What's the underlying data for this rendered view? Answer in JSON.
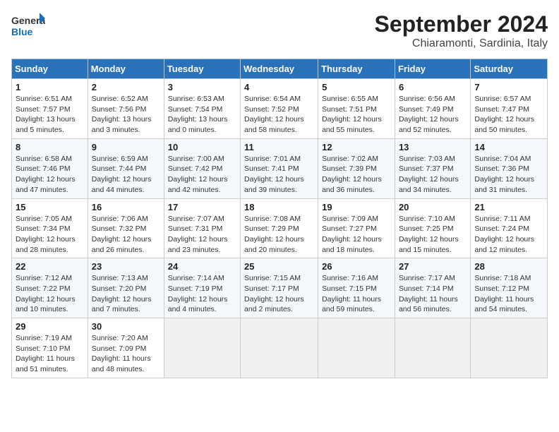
{
  "header": {
    "logo_general": "General",
    "logo_blue": "Blue",
    "month": "September 2024",
    "location": "Chiaramonti, Sardinia, Italy"
  },
  "weekdays": [
    "Sunday",
    "Monday",
    "Tuesday",
    "Wednesday",
    "Thursday",
    "Friday",
    "Saturday"
  ],
  "weeks": [
    [
      {
        "day": "1",
        "sunrise": "6:51 AM",
        "sunset": "7:57 PM",
        "daylight": "13 hours and 5 minutes."
      },
      {
        "day": "2",
        "sunrise": "6:52 AM",
        "sunset": "7:56 PM",
        "daylight": "13 hours and 3 minutes."
      },
      {
        "day": "3",
        "sunrise": "6:53 AM",
        "sunset": "7:54 PM",
        "daylight": "13 hours and 0 minutes."
      },
      {
        "day": "4",
        "sunrise": "6:54 AM",
        "sunset": "7:52 PM",
        "daylight": "12 hours and 58 minutes."
      },
      {
        "day": "5",
        "sunrise": "6:55 AM",
        "sunset": "7:51 PM",
        "daylight": "12 hours and 55 minutes."
      },
      {
        "day": "6",
        "sunrise": "6:56 AM",
        "sunset": "7:49 PM",
        "daylight": "12 hours and 52 minutes."
      },
      {
        "day": "7",
        "sunrise": "6:57 AM",
        "sunset": "7:47 PM",
        "daylight": "12 hours and 50 minutes."
      }
    ],
    [
      {
        "day": "8",
        "sunrise": "6:58 AM",
        "sunset": "7:46 PM",
        "daylight": "12 hours and 47 minutes."
      },
      {
        "day": "9",
        "sunrise": "6:59 AM",
        "sunset": "7:44 PM",
        "daylight": "12 hours and 44 minutes."
      },
      {
        "day": "10",
        "sunrise": "7:00 AM",
        "sunset": "7:42 PM",
        "daylight": "12 hours and 42 minutes."
      },
      {
        "day": "11",
        "sunrise": "7:01 AM",
        "sunset": "7:41 PM",
        "daylight": "12 hours and 39 minutes."
      },
      {
        "day": "12",
        "sunrise": "7:02 AM",
        "sunset": "7:39 PM",
        "daylight": "12 hours and 36 minutes."
      },
      {
        "day": "13",
        "sunrise": "7:03 AM",
        "sunset": "7:37 PM",
        "daylight": "12 hours and 34 minutes."
      },
      {
        "day": "14",
        "sunrise": "7:04 AM",
        "sunset": "7:36 PM",
        "daylight": "12 hours and 31 minutes."
      }
    ],
    [
      {
        "day": "15",
        "sunrise": "7:05 AM",
        "sunset": "7:34 PM",
        "daylight": "12 hours and 28 minutes."
      },
      {
        "day": "16",
        "sunrise": "7:06 AM",
        "sunset": "7:32 PM",
        "daylight": "12 hours and 26 minutes."
      },
      {
        "day": "17",
        "sunrise": "7:07 AM",
        "sunset": "7:31 PM",
        "daylight": "12 hours and 23 minutes."
      },
      {
        "day": "18",
        "sunrise": "7:08 AM",
        "sunset": "7:29 PM",
        "daylight": "12 hours and 20 minutes."
      },
      {
        "day": "19",
        "sunrise": "7:09 AM",
        "sunset": "7:27 PM",
        "daylight": "12 hours and 18 minutes."
      },
      {
        "day": "20",
        "sunrise": "7:10 AM",
        "sunset": "7:25 PM",
        "daylight": "12 hours and 15 minutes."
      },
      {
        "day": "21",
        "sunrise": "7:11 AM",
        "sunset": "7:24 PM",
        "daylight": "12 hours and 12 minutes."
      }
    ],
    [
      {
        "day": "22",
        "sunrise": "7:12 AM",
        "sunset": "7:22 PM",
        "daylight": "12 hours and 10 minutes."
      },
      {
        "day": "23",
        "sunrise": "7:13 AM",
        "sunset": "7:20 PM",
        "daylight": "12 hours and 7 minutes."
      },
      {
        "day": "24",
        "sunrise": "7:14 AM",
        "sunset": "7:19 PM",
        "daylight": "12 hours and 4 minutes."
      },
      {
        "day": "25",
        "sunrise": "7:15 AM",
        "sunset": "7:17 PM",
        "daylight": "12 hours and 2 minutes."
      },
      {
        "day": "26",
        "sunrise": "7:16 AM",
        "sunset": "7:15 PM",
        "daylight": "11 hours and 59 minutes."
      },
      {
        "day": "27",
        "sunrise": "7:17 AM",
        "sunset": "7:14 PM",
        "daylight": "11 hours and 56 minutes."
      },
      {
        "day": "28",
        "sunrise": "7:18 AM",
        "sunset": "7:12 PM",
        "daylight": "11 hours and 54 minutes."
      }
    ],
    [
      {
        "day": "29",
        "sunrise": "7:19 AM",
        "sunset": "7:10 PM",
        "daylight": "11 hours and 51 minutes."
      },
      {
        "day": "30",
        "sunrise": "7:20 AM",
        "sunset": "7:09 PM",
        "daylight": "11 hours and 48 minutes."
      },
      null,
      null,
      null,
      null,
      null
    ]
  ]
}
